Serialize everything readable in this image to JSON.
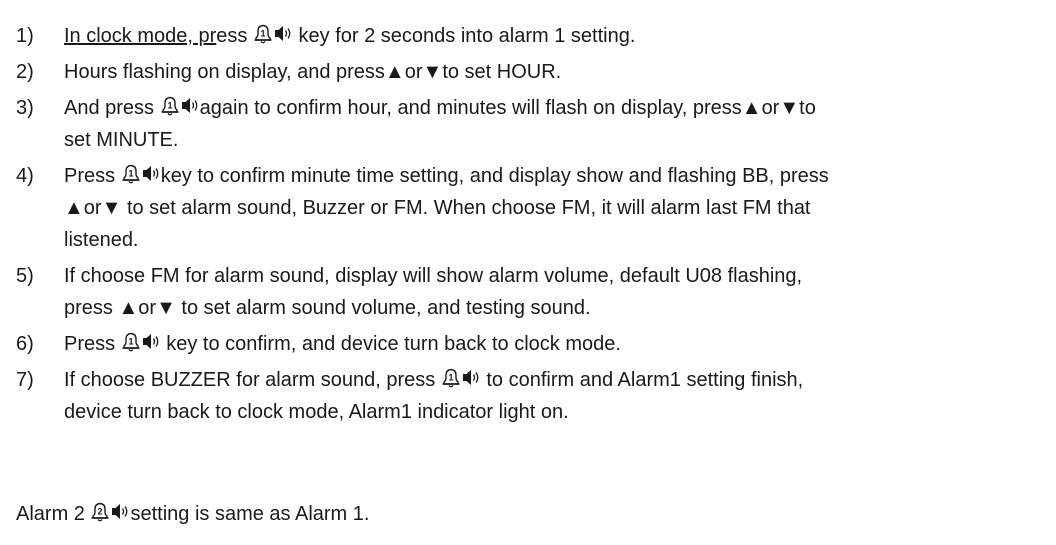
{
  "steps": [
    {
      "num": "1)",
      "a": "In clock mode, pr",
      "b": "ess",
      "c": " key for 2 seconds into alarm 1 setting."
    },
    {
      "num": "2)",
      "a": "Hours flashing on display, and press",
      "b": "or",
      "c": "to set HOUR."
    },
    {
      "num": "3)",
      "a": "And press",
      "b": "again to confirm hour, and minutes will flash on display, press",
      "c": "or",
      "d": "to",
      "e": "set MINUTE."
    },
    {
      "num": "4)",
      "a": "Press",
      "b": "key to confirm minute time setting, and display show and flashing BB, press",
      "c": "or",
      "d": " to set alarm sound, Buzzer or FM. When choose FM, it will alarm last FM that",
      "e": "listened."
    },
    {
      "num": "5)",
      "a": "If choose FM for alarm sound, display will show alarm volume, default U08 flashing,",
      "b": "press",
      "c": "or",
      "d": " to set alarm sound volume, and testing sound."
    },
    {
      "num": "6)",
      "a": "Press",
      "b": " key to confirm, and device turn back to clock mode."
    },
    {
      "num": "7)",
      "a": "If choose BUZZER for alarm sound, press",
      "b": " to confirm and Alarm1 setting finish,",
      "c": "device turn back to clock mode, Alarm1 indicator light on."
    }
  ],
  "footer": {
    "a": "Alarm 2",
    "b": "setting is same as Alarm 1."
  },
  "icons": {
    "alarm1": "alarm-bell-1-speaker-icon",
    "alarm2": "alarm-bell-2-speaker-icon",
    "up": "up-triangle-icon",
    "down": "down-triangle-icon"
  }
}
